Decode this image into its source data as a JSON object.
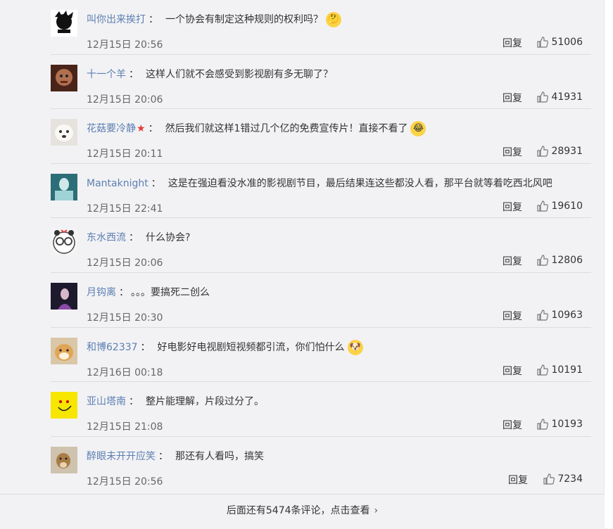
{
  "comments": [
    {
      "user": "叫你出来挨打",
      "text": "一个协会有制定这种规则的权利吗？",
      "time": "12月15日 20:56",
      "reply": "回复",
      "likes": "51006",
      "emoji": "thinking-face",
      "avatar": "#1a1a1a"
    },
    {
      "user": "十一个羊",
      "text": "这样人们就不会感受到影视剧有多无聊了？",
      "time": "12月15日 20:06",
      "reply": "回复",
      "likes": "41931",
      "emoji": "",
      "avatar": "#7a3b2a"
    },
    {
      "user": "花菇要冷静",
      "text": "然后我们就这样1错过几个亿的免费宣传片！直接不看了",
      "time": "12月15日 20:11",
      "reply": "回复",
      "likes": "28931",
      "emoji": "crying-face",
      "avatar": "#d9d6d0",
      "vip": true
    },
    {
      "user": "Mantaknight",
      "text": "这是在强迫看没水准的影视剧节目，最后结果连这些都没人看，那平台就等着吃西北风吧",
      "time": "12月15日 22:41",
      "reply": "回复",
      "likes": "19610",
      "emoji": "",
      "avatar": "#4aa7a9"
    },
    {
      "user": "东水西流",
      "text": "什么协会?",
      "time": "12月15日 20:06",
      "reply": "回复",
      "likes": "12806",
      "emoji": "",
      "avatar": "#eeeeee"
    },
    {
      "user": "月钩离",
      "text": "。。。要搞死二创么",
      "time": "12月15日 20:30",
      "reply": "回复",
      "likes": "10963",
      "emoji": "",
      "avatar": "#3b2a4a"
    },
    {
      "user": "和博62337",
      "text": "好电影好电视剧短视频都引流，你们怕什么",
      "time": "12月16日 00:18",
      "reply": "回复",
      "likes": "10191",
      "emoji": "doge-face",
      "avatar": "#c8a06a"
    },
    {
      "user": "亚山塔南",
      "text": "整片能理解，片段过分了。",
      "time": "12月15日 21:08",
      "reply": "回复",
      "likes": "10193",
      "emoji": "",
      "avatar": "#f6e400"
    },
    {
      "user": "醉眼未开开应笑",
      "text": "那还有人看吗，搞笑",
      "time": "12月15日 20:56",
      "reply": "回复",
      "likes": "7234",
      "emoji": "",
      "avatar": "#b9a58a"
    }
  ],
  "footer": {
    "more_label": "后面还有5474条评论，点击查看"
  },
  "colors": {
    "username": "#5c7fb0",
    "background": "#f2f2f5"
  }
}
